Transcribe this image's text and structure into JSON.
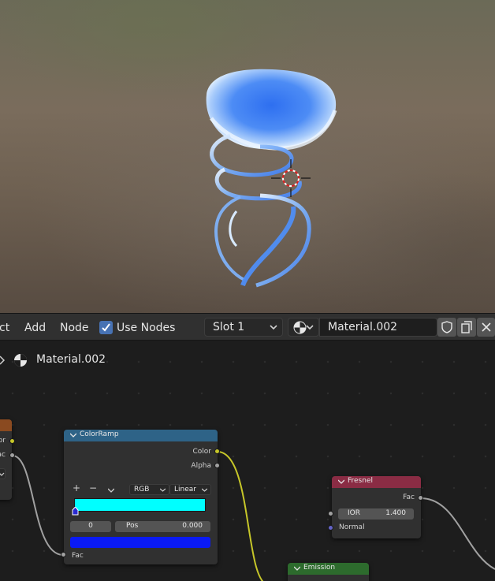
{
  "header": {
    "menu_partial": "ct",
    "menu_add": "Add",
    "menu_node": "Node",
    "use_nodes_label": "Use Nodes",
    "use_nodes_checked": true,
    "slot": "Slot 1",
    "material_name": "Material.002"
  },
  "breadcrumb": {
    "material": "Material.002"
  },
  "nodes": {
    "left_partial": {
      "out_color": "or",
      "out_fac": "ac"
    },
    "colorramp": {
      "title": "ColorRamp",
      "out_color": "Color",
      "out_alpha": "Alpha",
      "add": "+",
      "remove": "−",
      "color_mode": "RGB",
      "interpolation": "Linear",
      "ramp_start_color": "#00ffff",
      "stop_index": "0",
      "pos_label": "Pos",
      "pos_value": "0.000",
      "stop_color": "#0a1af5",
      "in_fac": "Fac"
    },
    "fresnel": {
      "title": "Fresnel",
      "out_fac": "Fac",
      "ior_label": "IOR",
      "ior_value": "1.400",
      "in_normal": "Normal"
    },
    "emission": {
      "title": "Emission"
    }
  },
  "colors": {
    "converter_header": "#2e6387",
    "input_header": "#8a2c44",
    "shader_header": "#2d6b2d",
    "texture_header": "#8a4a20",
    "socket_color": "#c7c729",
    "socket_float": "#a1a1a1",
    "socket_vector": "#6363c7",
    "accent": "#4772b3"
  }
}
